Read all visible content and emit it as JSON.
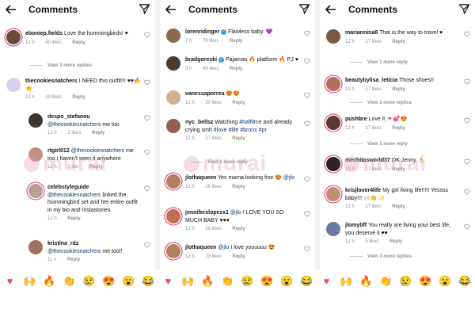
{
  "header": {
    "title": "Comments"
  },
  "panels": [
    {
      "comments": [
        {
          "user": "eboniep.fields",
          "text": "Love the hummingbirds! ♥",
          "time": "12 h",
          "likes": "40 likes",
          "reply": "Reply",
          "avatar_color": "#6b4a3a",
          "story": true
        },
        {
          "view_replies": "View 3 more replies"
        },
        {
          "user": "thecookiesnatchers",
          "text": "I NEED this outfit!!! ♥♥🔥👏",
          "time": "12 h",
          "likes": "19 likes",
          "reply": "Reply",
          "avatar_color": "#d8d0f0",
          "story": false
        },
        {
          "user": "despo_stefanou",
          "mention": "@thecookiesnatchers",
          "text": " me too",
          "time": "12 h",
          "likes": "2 likes",
          "reply": "Reply",
          "avatar_color": "#3d3530",
          "story": false,
          "is_reply": true
        },
        {
          "user": "rtgirl012",
          "mention": "@thecookiesnatchers",
          "text": " me too I haven't seen it anywhere",
          "time": "12 h",
          "likes": "1 like",
          "reply": "Reply",
          "avatar_color": "#c09080",
          "story": false,
          "is_reply": true
        },
        {
          "user": "celebstyleguide",
          "mention": "@thecookiesnatchers",
          "text": " linked the hummingbird set and her entire outfit in my bio and Instastories",
          "time": "12 h",
          "likes": "",
          "reply": "Reply",
          "avatar_color": "#b8a090",
          "story": true,
          "is_reply": true
        },
        {
          "user": "kristina_rdz",
          "mention": "@thecookiesnatchers",
          "text": " me too!!",
          "time": "11 h",
          "likes": "",
          "reply": "Reply",
          "avatar_color": "#a07060",
          "story": false,
          "is_reply": true
        }
      ]
    },
    {
      "comments": [
        {
          "user": "lorenridinger",
          "verified": true,
          "text": "Flawless baby. 💜",
          "time": "7 h",
          "likes": "70 likes",
          "reply": "Reply",
          "avatar_color": "#8a6a50",
          "story": false
        },
        {
          "user": "bradgoreski",
          "verified": true,
          "text": "Pajamas 🔥 platform 🔥 PJ ♥",
          "time": "3 h",
          "likes": "49 likes",
          "reply": "Reply",
          "avatar_color": "#4a3a30",
          "story": false
        },
        {
          "user": "vanessaporrea",
          "text": "😍😍",
          "time": "12 h",
          "likes": "30 likes",
          "reply": "Reply",
          "avatar_color": "#d0b090",
          "story": false
        },
        {
          "user": "nyc_bellsz",
          "text": "Watching ",
          "hashtags": "#halftime",
          "text2": " and already crying smh ",
          "hashtags2": "#love #life #bronx #pr",
          "time": "12 h",
          "likes": "17 likes",
          "reply": "Reply",
          "avatar_color": "#906050",
          "story": false
        },
        {
          "view_replies": "View 1 more reply"
        },
        {
          "user": "jlothaqueen",
          "text": "Yes mama looking fine 😍 ",
          "mention": "@jlo",
          "time": "12 h",
          "likes": "16 likes",
          "reply": "Reply",
          "avatar_color": "#b08060",
          "story": true
        },
        {
          "user": "jenniferxlopezx1",
          "mention": "@jlo",
          "text": " I LOVE YOU SO MUCH BABY ♥♥♥",
          "time": "12 h",
          "likes": "28 likes",
          "reply": "Reply",
          "avatar_color": "#c07050",
          "story": true
        },
        {
          "user": "jlothaqueen",
          "mention": "@jlo",
          "text": " I love youuuuu 😍",
          "time": "12 h",
          "likes": "23 likes",
          "reply": "Reply",
          "avatar_color": "#b08060",
          "story": true
        }
      ]
    },
    {
      "comments": [
        {
          "user": "mariannina8",
          "text": "That is the way to travel ♥",
          "time": "12 h",
          "likes": "17 likes",
          "reply": "Reply",
          "avatar_color": "#7a5a40",
          "story": false
        },
        {
          "view_replies": "View 1 more reply"
        },
        {
          "user": "beautybylisa_leticia",
          "text": "Those shoes!!",
          "time": "12 h",
          "likes": "17 likes",
          "reply": "Reply",
          "avatar_color": "#b07060",
          "story": true
        },
        {
          "view_replies": "View 3 more replies"
        },
        {
          "user": "pushbre",
          "text": "Love it 💌💕😍",
          "time": "12 h",
          "likes": "17 likes",
          "reply": "Reply",
          "avatar_color": "#5a3a30",
          "story": true
        },
        {
          "view_replies": "View 1 more reply"
        },
        {
          "user": "mechitasworld37",
          "text": "OK Jenny 👌",
          "time": "12 h",
          "likes": "17 likes",
          "reply": "Reply",
          "avatar_color": "#2a2520",
          "story": true
        },
        {
          "user": "krisjlover4life",
          "text": "My girl living life!!!!! Yessss baby!!! 🙌🏻👏 ✨",
          "time": "12 h",
          "likes": "17 likes",
          "reply": "Reply",
          "avatar_color": "#c09070",
          "story": true
        },
        {
          "user": "jlomybff",
          "text": "You really are living your best life, you deserve it ♥♥",
          "time": "12 h",
          "likes": "5 likes",
          "reply": "Reply",
          "avatar_color": "#6a7aa0",
          "story": false
        },
        {
          "view_replies": "View 3 more replies"
        }
      ]
    }
  ],
  "watermark": "murai",
  "emoji_bar": [
    "♥",
    "🙌",
    "🔥",
    "👏",
    "😢",
    "😍",
    "😮",
    "😂",
    "♥",
    "🙌",
    "🔥",
    "👏",
    "😢",
    "😍",
    "😮",
    "😂",
    "♥",
    "🙌",
    "🔥",
    "👏",
    "😢",
    "😍",
    "😮",
    "😂"
  ]
}
